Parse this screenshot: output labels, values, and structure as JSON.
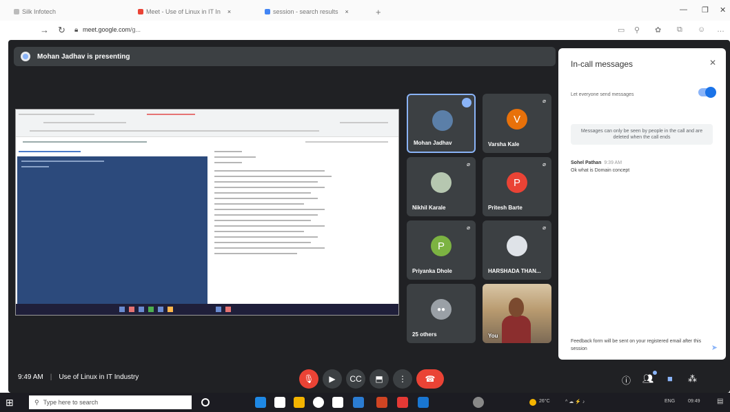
{
  "browser": {
    "tabs": [
      {
        "label": "Silk Infotech"
      },
      {
        "label": "Meet - Use of Linux in IT In"
      },
      {
        "label": "session - search results"
      }
    ],
    "new_tab": "+",
    "url_host": "meet.google.com",
    "url_path": "/g..."
  },
  "meeting": {
    "presenting_banner": "Mohan Jadhav is presenting",
    "time": "9:49 AM",
    "title": "Use of Linux in IT Industry"
  },
  "participants": [
    {
      "name": "Mohan Jadhav",
      "initial": "",
      "avatar_color": "#5b7fa8",
      "active": true
    },
    {
      "name": "Varsha Kale",
      "initial": "V",
      "avatar_color": "#e8710a",
      "active": false
    },
    {
      "name": "Nikhil Karale",
      "initial": "",
      "avatar_color": "#b6c7b0",
      "active": false
    },
    {
      "name": "Pritesh Barte",
      "initial": "P",
      "avatar_color": "#ea4335",
      "active": false
    },
    {
      "name": "Priyanka Dhole",
      "initial": "P",
      "avatar_color": "#7cb342",
      "active": false
    },
    {
      "name": "HARSHADA THAN...",
      "initial": "",
      "avatar_color": "#dfe3e8",
      "active": false
    },
    {
      "name": "25 others",
      "initial": "",
      "avatar_color": "#9aa0a6",
      "active": false
    },
    {
      "name": "You",
      "initial": "",
      "avatar_color": "",
      "active": false
    }
  ],
  "chat": {
    "title": "In-call messages",
    "toggle_label": "Let everyone send messages",
    "notice": "Messages can only be seen by people in the call and are deleted when the call ends",
    "messages": [
      {
        "sender": "Sohel Pathan",
        "time": "9:39 AM",
        "text": "Ok what is Domain concept"
      }
    ],
    "footer_text": "Feedback form will be sent on your registered email after this session"
  },
  "taskbar": {
    "search_placeholder": "Type here to search",
    "weather": "26°C",
    "lang": "ENG",
    "clock": "09:49"
  },
  "colors": {
    "meet_bg": "#202124",
    "tile_bg": "#3c4043",
    "accent": "#8ab4f8",
    "end_call": "#ea4335"
  }
}
